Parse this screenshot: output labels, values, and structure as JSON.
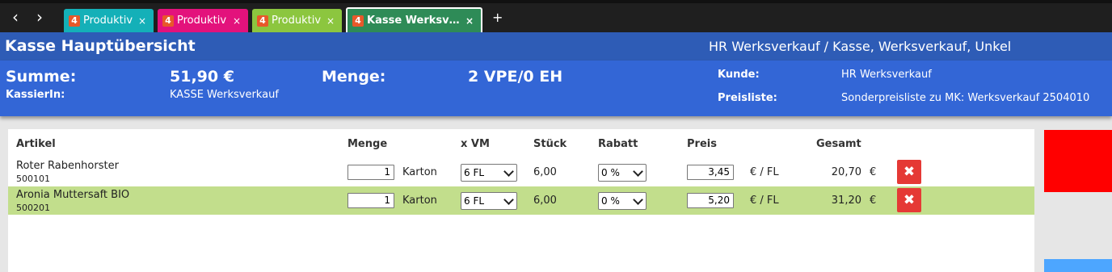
{
  "browser": {
    "back_icon": "‹",
    "forward_icon": "›",
    "tabs": [
      {
        "label": "Produktiv",
        "close": "×",
        "color": "#14b0b8"
      },
      {
        "label": "Produktiv",
        "close": "×",
        "color": "#e3127c"
      },
      {
        "label": "Produktiv",
        "close": "×",
        "color": "#8cc63f"
      },
      {
        "label": "Kasse Werksv…",
        "close": "×",
        "color": "#2e8b57"
      }
    ],
    "tab_logo": "4",
    "add_tab": "+"
  },
  "header": {
    "title": "Kasse Hauptübersicht",
    "location": "HR Werksverkauf / Kasse, Werksverkauf, Unkel"
  },
  "summary": {
    "sum_label": "Summe:",
    "sum_value": "51,90 €",
    "qty_label": "Menge:",
    "qty_value": "2 VPE/0 EH",
    "cashier_label": "KassierIn:",
    "cashier_value": "KASSE Werksverkauf",
    "customer_label": "Kunde:",
    "customer_value": "HR Werksverkauf",
    "pricelist_label": "Preisliste:",
    "pricelist_value": "Sonderpreisliste zu MK: Werksverkauf 2504010"
  },
  "table": {
    "headers": [
      "Artikel",
      "Menge",
      "x VM",
      "Stück",
      "Rabatt",
      "Preis",
      "Gesamt"
    ],
    "rows": [
      {
        "name": "Roter Rabenhorster",
        "number": "500101",
        "qty": "1",
        "unit": "Karton",
        "vm": "6 FL",
        "pieces": "6,00",
        "discount": "0 %",
        "price": "3,45",
        "price_unit": "€ / FL",
        "total": "20,70",
        "currency": "€",
        "delete_icon": "✖"
      },
      {
        "name": "Aronia Muttersaft BIO",
        "number": "500201",
        "qty": "1",
        "unit": "Karton",
        "vm": "6 FL",
        "pieces": "6,00",
        "discount": "0 %",
        "price": "5,20",
        "price_unit": "€ / FL",
        "total": "31,20",
        "currency": "€",
        "delete_icon": "✖"
      }
    ]
  }
}
